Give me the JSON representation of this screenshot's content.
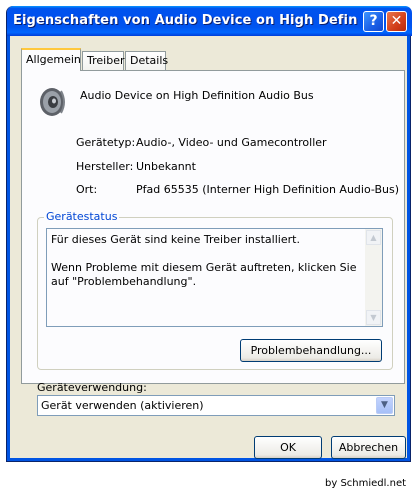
{
  "window": {
    "title": "Eigenschaften von Audio Device on High Definition Au...",
    "help_label": "?",
    "close_label": "✕"
  },
  "tabs": [
    {
      "label": "Allgemein",
      "active": true
    },
    {
      "label": "Treiber",
      "active": false
    },
    {
      "label": "Details",
      "active": false
    }
  ],
  "device": {
    "icon": "speaker-icon",
    "name": "Audio Device on High Definition Audio Bus"
  },
  "properties": [
    {
      "label": "Gerätetyp:",
      "value": "Audio-, Video- und Gamecontroller"
    },
    {
      "label": "Hersteller:",
      "value": "Unbekannt"
    },
    {
      "label": "Ort:",
      "value": "Pfad 65535 (Interner High Definition Audio-Bus)"
    }
  ],
  "status": {
    "legend": "Gerätestatus",
    "text": "Für dieses Gerät sind keine Treiber installiert.\n\nWenn Probleme mit diesem Gerät auftreten, klicken Sie auf \"Problembehandlung\".",
    "troubleshoot_label": "Problembehandlung..."
  },
  "usage": {
    "label": "Geräteverwendung:",
    "selected": "Gerät verwenden (aktivieren)"
  },
  "buttons": {
    "ok": "OK",
    "cancel": "Abbrechen"
  },
  "credit": "by Schmiedl.net",
  "colors": {
    "titlebar": "#0055f0",
    "dialog_bg": "#ece9d8",
    "group_legend": "#0046d5",
    "close_button": "#d23f1a"
  }
}
